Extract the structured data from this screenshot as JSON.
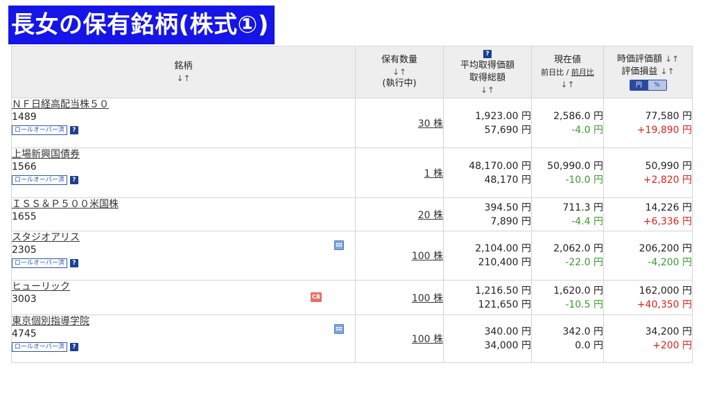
{
  "title": "長女の保有銘柄(株式①)",
  "header": {
    "name": "銘柄",
    "name_sort": "↓↑",
    "qty_line1": "保有数量",
    "qty_sort": "↓↑",
    "qty_line2": "(執行中)",
    "avg_help": "?",
    "avg_line1": "平均取得価額",
    "avg_line2": "取得総額",
    "avg_sort": "↓↑",
    "price_line1": "現在値",
    "price_line2a": "前日比",
    "price_sep": "/",
    "price_line2b": "前月比",
    "price_sort": "↓↑",
    "val_line1": "時価評価額",
    "val_sort1": "↓↑",
    "val_line2": "評価損益",
    "val_sort2": "↓↑",
    "toggle_yen": "円",
    "toggle_pct": "%"
  },
  "rollover_label": "ロールオーバー済",
  "help_glyph": "?",
  "cb_label": "CB",
  "rows": [
    {
      "name": "ＮＦ日経高配当株５０",
      "code": "1489",
      "rollover": "ロールオーバー済",
      "help": "?",
      "qty": "30 株",
      "avg": "1,923.00 円",
      "total": "57,690 円",
      "price": "2,586.0 円",
      "change": "-4.0 円",
      "value": "77,580 円",
      "pl": "+19,890 円"
    },
    {
      "name": "上場新興国債券",
      "code": "1566",
      "rollover": "ロールオーバー済",
      "help": "?",
      "qty": "1 株",
      "avg": "48,170.00 円",
      "total": "48,170 円",
      "price": "50,990.0 円",
      "change": "-10.0 円",
      "value": "50,990 円",
      "pl": "+2,820 円"
    },
    {
      "name": "ＩＳＳ＆Ｐ５００米国株",
      "code": "1655",
      "qty": "20 株",
      "avg": "394.50 円",
      "total": "7,890 円",
      "price": "711.3 円",
      "change": "-4.4 円",
      "value": "14,226 円",
      "pl": "+6,336 円"
    },
    {
      "name": "スタジオアリス",
      "code": "2305",
      "rollover": "ロールオーバー済",
      "help": "?",
      "qty": "100 株",
      "avg": "2,104.00 円",
      "total": "210,400 円",
      "price": "2,062.0 円",
      "change": "-22.0 円",
      "value": "206,200 円",
      "pl": "-4,200 円"
    },
    {
      "name": "ヒューリック",
      "code": "3003",
      "qty": "100 株",
      "avg": "1,216.50 円",
      "total": "121,650 円",
      "price": "1,620.0 円",
      "change": "-10.5 円",
      "value": "162,000 円",
      "pl": "+40,350 円"
    },
    {
      "name": "東京個別指導学院",
      "code": "4745",
      "rollover": "ロールオーバー済",
      "help": "?",
      "qty": "100 株",
      "avg": "340.00 円",
      "total": "34,000 円",
      "price": "342.0 円",
      "change": "0.0 円",
      "value": "34,200 円",
      "pl": "+200 円"
    }
  ],
  "colors": {
    "title_bg": "#1515e8",
    "positive": "#e0201b",
    "negative": "#3c9b2e",
    "header_bg": "#eeeeee",
    "accent": "#2a4a9c"
  }
}
